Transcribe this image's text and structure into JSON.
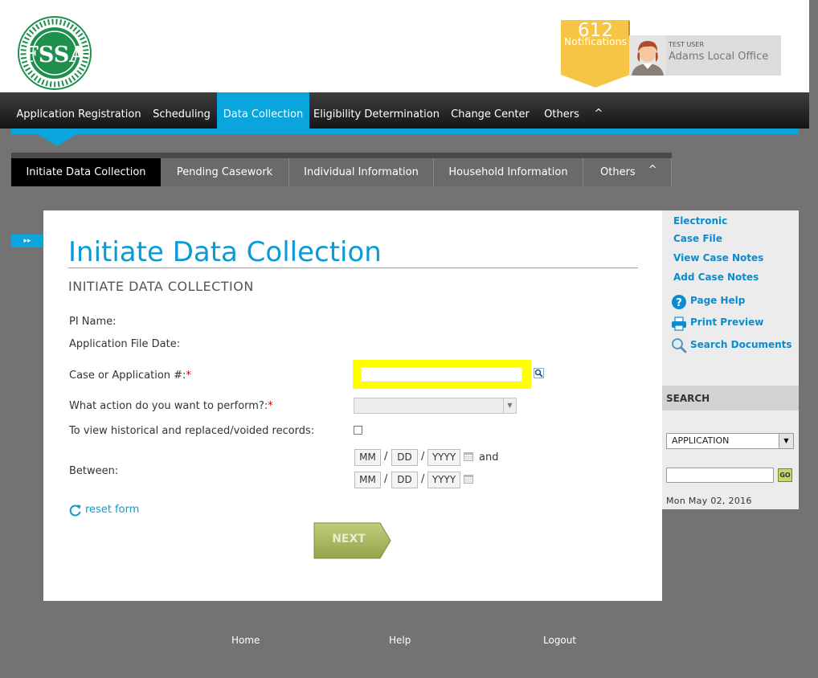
{
  "header": {
    "logo_text": "FSSA",
    "logo_ring_text": "INDIANA FAMILY & SOCIAL SERVICES ADMINISTRATION",
    "notifications": {
      "count": "612",
      "label": "Notifications"
    },
    "user": {
      "role": "TEST USER",
      "office": "Adams Local Office"
    }
  },
  "main_nav": {
    "items": [
      {
        "label": "Application Registration"
      },
      {
        "label": "Scheduling"
      },
      {
        "label": "Data Collection",
        "active": true
      },
      {
        "label": "Eligibility Determination"
      },
      {
        "label": "Change Center"
      },
      {
        "label": "Others"
      }
    ],
    "caret": "^"
  },
  "sub_nav": {
    "items": [
      {
        "label": "Initiate Data Collection",
        "active": true
      },
      {
        "label": "Pending Casework"
      },
      {
        "label": "Individual Information"
      },
      {
        "label": "Household Information"
      },
      {
        "label": "Others"
      }
    ],
    "caret": "^"
  },
  "side_tab_glyph": "▸▸",
  "page": {
    "title": "Initiate Data Collection",
    "section_title": "INITIATE DATA COLLECTION",
    "fields": {
      "pi_name": "PI Name:",
      "app_file_date": "Application File Date:",
      "case_number": "Case or Application #:",
      "action": "What action do you want to perform?:",
      "historical": "To view historical and replaced/voided records:",
      "between": "Between:",
      "required_mark": "*"
    },
    "date_range": {
      "mm": "MM",
      "dd": "DD",
      "yyyy": "YYYY",
      "sep": "/",
      "and": "and"
    },
    "reset_label": "reset form",
    "next_label": "NEXT"
  },
  "sidebar": {
    "links": {
      "electronic": "Electronic",
      "case_file": "Case File",
      "view_notes": "View Case Notes",
      "add_notes": "Add Case Notes",
      "page_help": "Page Help",
      "print_preview": "Print Preview",
      "search_docs": "Search Documents"
    },
    "search": {
      "title": "SEARCH",
      "selected_option": "APPLICATION",
      "go_label": "GO",
      "date": "Mon May 02, 2016"
    }
  },
  "footer": {
    "home": "Home",
    "help": "Help",
    "logout": "Logout"
  },
  "colors": {
    "accent": "#0aa5dc",
    "highlight": "#ffff00",
    "background": "#737373",
    "next_button": "#a9b85a"
  }
}
